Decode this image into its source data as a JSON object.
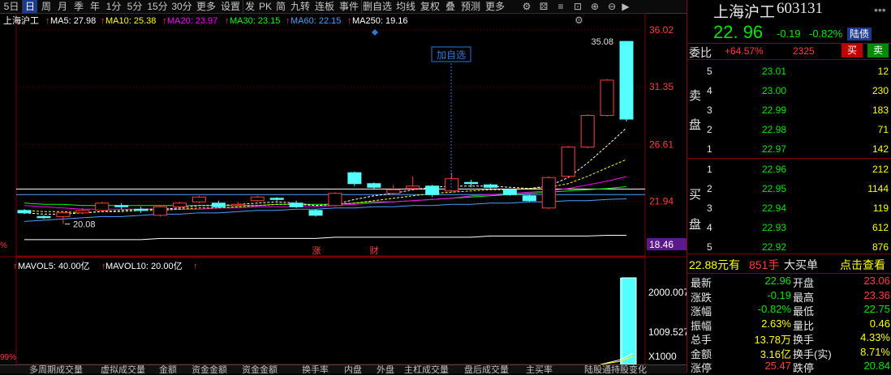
{
  "toolbar": {
    "items": [
      "5日",
      "日",
      "周",
      "月",
      "季",
      "年",
      "1分",
      "5分",
      "15分",
      "30分",
      "更多",
      "设置",
      "发",
      "PK",
      "简",
      "九转",
      "连板",
      "事件",
      "删自选",
      "均线",
      "复权",
      "叠",
      "预测",
      "更多"
    ],
    "selected": "日"
  },
  "ma_legend": {
    "name": "上海沪工",
    "ma5": "MA5: 27.98",
    "ma10": "MA10: 25.38",
    "ma20": "MA20: 23.97",
    "ma30": "MA30: 23.15",
    "ma60": "MA60: 22.15",
    "ma250": "MA250: 19.16"
  },
  "price_axis": {
    "labels": [
      "36.02",
      "31.35",
      "26.61",
      "21.94",
      "18.46"
    ],
    "high_marker": "35.08",
    "low_marker": "20.08"
  },
  "add_watchlist_label": "加自选",
  "event_tags": [
    "涨",
    "财"
  ],
  "left_edge": {
    "pct_top": "%",
    "pct_bottom": "99%"
  },
  "volume_legend": {
    "mavol5": "MAVOL5: 40.00亿",
    "mavol10": "MAVOL10: 20.00亿"
  },
  "volume_axis": {
    "labels": [
      "2000.007",
      "1009.527"
    ],
    "unit": "X1000"
  },
  "chart_data": {
    "type": "candlestick",
    "series_names": [
      "MA5",
      "MA10",
      "MA20",
      "MA30",
      "MA60",
      "MA250"
    ],
    "ylim": [
      18.46,
      36.02
    ],
    "candles": [
      {
        "o": 21.2,
        "c": 21.0,
        "h": 21.3,
        "l": 20.9
      },
      {
        "o": 20.7,
        "c": 20.6,
        "h": 20.8,
        "l": 20.5
      },
      {
        "o": 20.7,
        "c": 21.0,
        "h": 21.1,
        "l": 20.08
      },
      {
        "o": 21.0,
        "c": 21.2,
        "h": 21.4,
        "l": 20.9
      },
      {
        "o": 21.2,
        "c": 21.8,
        "h": 21.9,
        "l": 21.1
      },
      {
        "o": 21.6,
        "c": 21.5,
        "h": 21.8,
        "l": 21.3
      },
      {
        "o": 21.3,
        "c": 21.2,
        "h": 21.5,
        "l": 21.0
      },
      {
        "o": 20.8,
        "c": 21.5,
        "h": 21.6,
        "l": 20.7
      },
      {
        "o": 21.5,
        "c": 21.8,
        "h": 21.9,
        "l": 21.4
      },
      {
        "o": 21.9,
        "c": 22.3,
        "h": 22.4,
        "l": 21.8
      },
      {
        "o": 21.8,
        "c": 21.5,
        "h": 22.0,
        "l": 21.4
      },
      {
        "o": 21.6,
        "c": 21.7,
        "h": 21.9,
        "l": 21.5
      },
      {
        "o": 22.0,
        "c": 22.3,
        "h": 22.4,
        "l": 21.9
      },
      {
        "o": 22.2,
        "c": 22.1,
        "h": 22.3,
        "l": 22.0
      },
      {
        "o": 21.8,
        "c": 21.5,
        "h": 22.0,
        "l": 21.4
      },
      {
        "o": 21.2,
        "c": 20.8,
        "h": 21.3,
        "l": 20.7
      },
      {
        "o": 21.6,
        "c": 22.6,
        "h": 22.7,
        "l": 21.5
      },
      {
        "o": 24.3,
        "c": 23.4,
        "h": 24.4,
        "l": 23.2
      },
      {
        "o": 23.4,
        "c": 23.1,
        "h": 23.5,
        "l": 22.9
      },
      {
        "o": 22.6,
        "c": 22.9,
        "h": 23.3,
        "l": 22.5
      },
      {
        "o": 23.0,
        "c": 23.2,
        "h": 24.0,
        "l": 22.9
      },
      {
        "o": 23.2,
        "c": 22.5,
        "h": 23.3,
        "l": 22.3
      },
      {
        "o": 22.8,
        "c": 23.8,
        "h": 24.3,
        "l": 22.7
      },
      {
        "o": 23.5,
        "c": 23.4,
        "h": 23.7,
        "l": 23.1
      },
      {
        "o": 23.3,
        "c": 23.1,
        "h": 23.4,
        "l": 23.0
      },
      {
        "o": 22.9,
        "c": 22.5,
        "h": 23.0,
        "l": 22.4
      },
      {
        "o": 22.4,
        "c": 22.0,
        "h": 22.5,
        "l": 21.9
      },
      {
        "o": 21.4,
        "c": 23.9,
        "h": 24.0,
        "l": 21.3
      },
      {
        "o": 24.0,
        "c": 26.4,
        "h": 26.5,
        "l": 23.9
      },
      {
        "o": 26.4,
        "c": 29.0,
        "h": 29.1,
        "l": 26.3
      },
      {
        "o": 29.0,
        "c": 31.9,
        "h": 32.0,
        "l": 28.9
      },
      {
        "o": 35.08,
        "c": 28.7,
        "h": 35.08,
        "l": 28.5
      }
    ],
    "ma5": [
      21.0,
      20.9,
      20.9,
      21.0,
      21.1,
      21.2,
      21.3,
      21.3,
      21.4,
      21.6,
      21.6,
      21.7,
      21.8,
      21.9,
      21.8,
      21.6,
      21.7,
      22.1,
      22.4,
      22.6,
      22.9,
      23.1,
      23.2,
      23.2,
      23.2,
      23.1,
      23.0,
      23.2,
      23.9,
      25.1,
      26.5,
      27.98
    ],
    "ma10": [
      21.2,
      21.1,
      21.1,
      21.0,
      21.1,
      21.1,
      21.2,
      21.2,
      21.3,
      21.4,
      21.4,
      21.5,
      21.6,
      21.7,
      21.7,
      21.6,
      21.7,
      21.8,
      22.0,
      22.2,
      22.4,
      22.6,
      22.7,
      22.8,
      22.9,
      22.9,
      23.0,
      23.1,
      23.4,
      24.0,
      24.7,
      25.38
    ],
    "ma20": [
      21.6,
      21.5,
      21.4,
      21.3,
      21.3,
      21.3,
      21.3,
      21.3,
      21.3,
      21.3,
      21.4,
      21.4,
      21.5,
      21.5,
      21.5,
      21.5,
      21.6,
      21.7,
      21.8,
      21.9,
      22.0,
      22.1,
      22.2,
      22.4,
      22.5,
      22.6,
      22.7,
      22.8,
      23.0,
      23.3,
      23.6,
      23.97
    ],
    "ma30": [
      21.8,
      21.7,
      21.7,
      21.6,
      21.6,
      21.6,
      21.6,
      21.6,
      21.6,
      21.6,
      21.6,
      21.6,
      21.6,
      21.7,
      21.7,
      21.7,
      21.7,
      21.8,
      21.9,
      21.9,
      22.0,
      22.1,
      22.2,
      22.3,
      22.4,
      22.5,
      22.6,
      22.7,
      22.8,
      22.9,
      23.0,
      23.15
    ],
    "ma60": [
      20.3,
      20.4,
      20.5,
      20.6,
      20.7,
      20.7,
      20.8,
      20.9,
      20.9,
      21.0,
      21.0,
      21.1,
      21.2,
      21.2,
      21.3,
      21.3,
      21.4,
      21.4,
      21.5,
      21.5,
      21.6,
      21.6,
      21.7,
      21.7,
      21.8,
      21.8,
      21.9,
      21.9,
      22.0,
      22.0,
      22.1,
      22.15
    ],
    "ma250": [
      18.8,
      18.8,
      18.8,
      18.8,
      18.8,
      18.8,
      18.8,
      18.9,
      18.9,
      18.9,
      18.9,
      18.9,
      18.9,
      18.9,
      18.9,
      18.9,
      19.0,
      19.0,
      19.0,
      19.0,
      19.0,
      19.0,
      19.0,
      19.0,
      19.1,
      19.1,
      19.1,
      19.1,
      19.1,
      19.1,
      19.16,
      19.16
    ],
    "volume_bars": [
      2000,
      2000
    ],
    "volume_ylim": [
      0,
      2000.007
    ]
  },
  "colors": {
    "up": "#ff3c3c",
    "down": "#54ffff",
    "ma5": "#ffffff",
    "ma10": "#ffff00",
    "ma20": "#ff00ff",
    "ma30": "#00ff00",
    "ma60": "#4f9cff",
    "ma250": "#ffffff",
    "panel_red": "#8b0000"
  },
  "quote": {
    "name": "上海沪工",
    "code": "603131",
    "price": "22. 96",
    "change": "-0.19",
    "change_pct": "-0.82%",
    "tag": "陆债",
    "weibi_label": "委比",
    "weibi_value": "+64.57%",
    "weicha_value": "2325",
    "buy_btn": "买",
    "sell_btn": "卖",
    "sell_side_label": [
      "卖",
      "盘"
    ],
    "buy_side_label": [
      "买",
      "盘"
    ],
    "asks": [
      {
        "level": "5",
        "price": "23.01",
        "vol": "12"
      },
      {
        "level": "4",
        "price": "23.00",
        "vol": "230"
      },
      {
        "level": "3",
        "price": "22.99",
        "vol": "183"
      },
      {
        "level": "2",
        "price": "22.98",
        "vol": "71"
      },
      {
        "level": "1",
        "price": "22.97",
        "vol": "142"
      }
    ],
    "bids": [
      {
        "level": "1",
        "price": "22.96",
        "vol": "212"
      },
      {
        "level": "2",
        "price": "22.95",
        "vol": "1144"
      },
      {
        "level": "3",
        "price": "22.94",
        "vol": "119"
      },
      {
        "level": "4",
        "price": "22.93",
        "vol": "612"
      },
      {
        "level": "5",
        "price": "22.92",
        "vol": "876"
      }
    ],
    "big_order": {
      "price": "22.88元有",
      "vol": "851手",
      "label": "大买单",
      "link": "点击查看"
    },
    "stats_left": [
      {
        "k": "最新",
        "v": "22.96"
      },
      {
        "k": "涨跌",
        "v": "-0.19"
      },
      {
        "k": "涨幅",
        "v": "-0.82%"
      },
      {
        "k": "振幅",
        "v": "2.63%"
      },
      {
        "k": "总手",
        "v": "13.78万"
      },
      {
        "k": "金额",
        "v": "3.16亿"
      },
      {
        "k": "涨停",
        "v": "25.47"
      }
    ],
    "stats_right": [
      {
        "k": "开盘",
        "v": "23.06"
      },
      {
        "k": "最高",
        "v": "23.36"
      },
      {
        "k": "最低",
        "v": "22.75"
      },
      {
        "k": "量比",
        "v": "0.46"
      },
      {
        "k": "换手",
        "v": "4.33%"
      },
      {
        "k": "换手(实)",
        "v": "8.71%"
      },
      {
        "k": "跌停",
        "v": "20.84"
      }
    ]
  },
  "bottom_tabs": [
    "多周期成交量",
    "虚拟成交量",
    "金额",
    "资金金额",
    "资金金额",
    "换手率",
    "内盘",
    "外盘",
    "主杠成交量",
    "盘后成交量",
    "主买率",
    "陆股通持股变化"
  ]
}
